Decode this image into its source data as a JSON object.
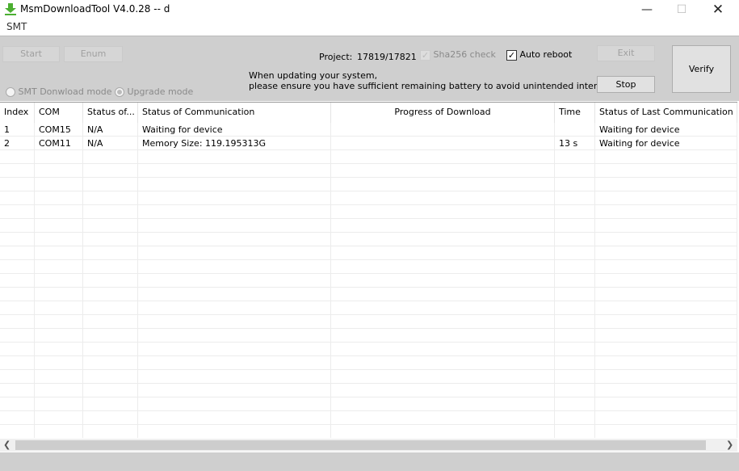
{
  "window": {
    "title": "MsmDownloadTool V4.0.28 -- d",
    "icon": "green-download-arrow-icon"
  },
  "menu": {
    "items": [
      "SMT"
    ]
  },
  "toolbar": {
    "start": "Start",
    "enum": "Enum",
    "project_label": "Project:",
    "project_value": "17819/17821",
    "sha256_check": "Sha256 check",
    "sha256_checked": true,
    "auto_reboot": "Auto reboot",
    "auto_reboot_checked": true,
    "exit": "Exit",
    "stop": "Stop",
    "verify": "Verify",
    "notice_line1": "When updating your system,",
    "notice_line2": "please ensure you have sufficient remaining battery to avoid unintended interruptions.",
    "mode_smt": "SMT Donwload mode",
    "mode_upgrade": "Upgrade mode"
  },
  "table": {
    "columns": [
      "Index",
      "COM",
      "Status of...",
      "Status of Communication",
      "Progress of Download",
      "Time",
      "Status of Last Communication"
    ],
    "rows": [
      [
        "1",
        "COM15",
        "N/A",
        "Waiting for device",
        "",
        "",
        "Waiting for device"
      ],
      [
        "2",
        "COM11",
        "N/A",
        "Memory Size: 119.195313G",
        "",
        "13 s",
        "Waiting for device"
      ]
    ]
  }
}
